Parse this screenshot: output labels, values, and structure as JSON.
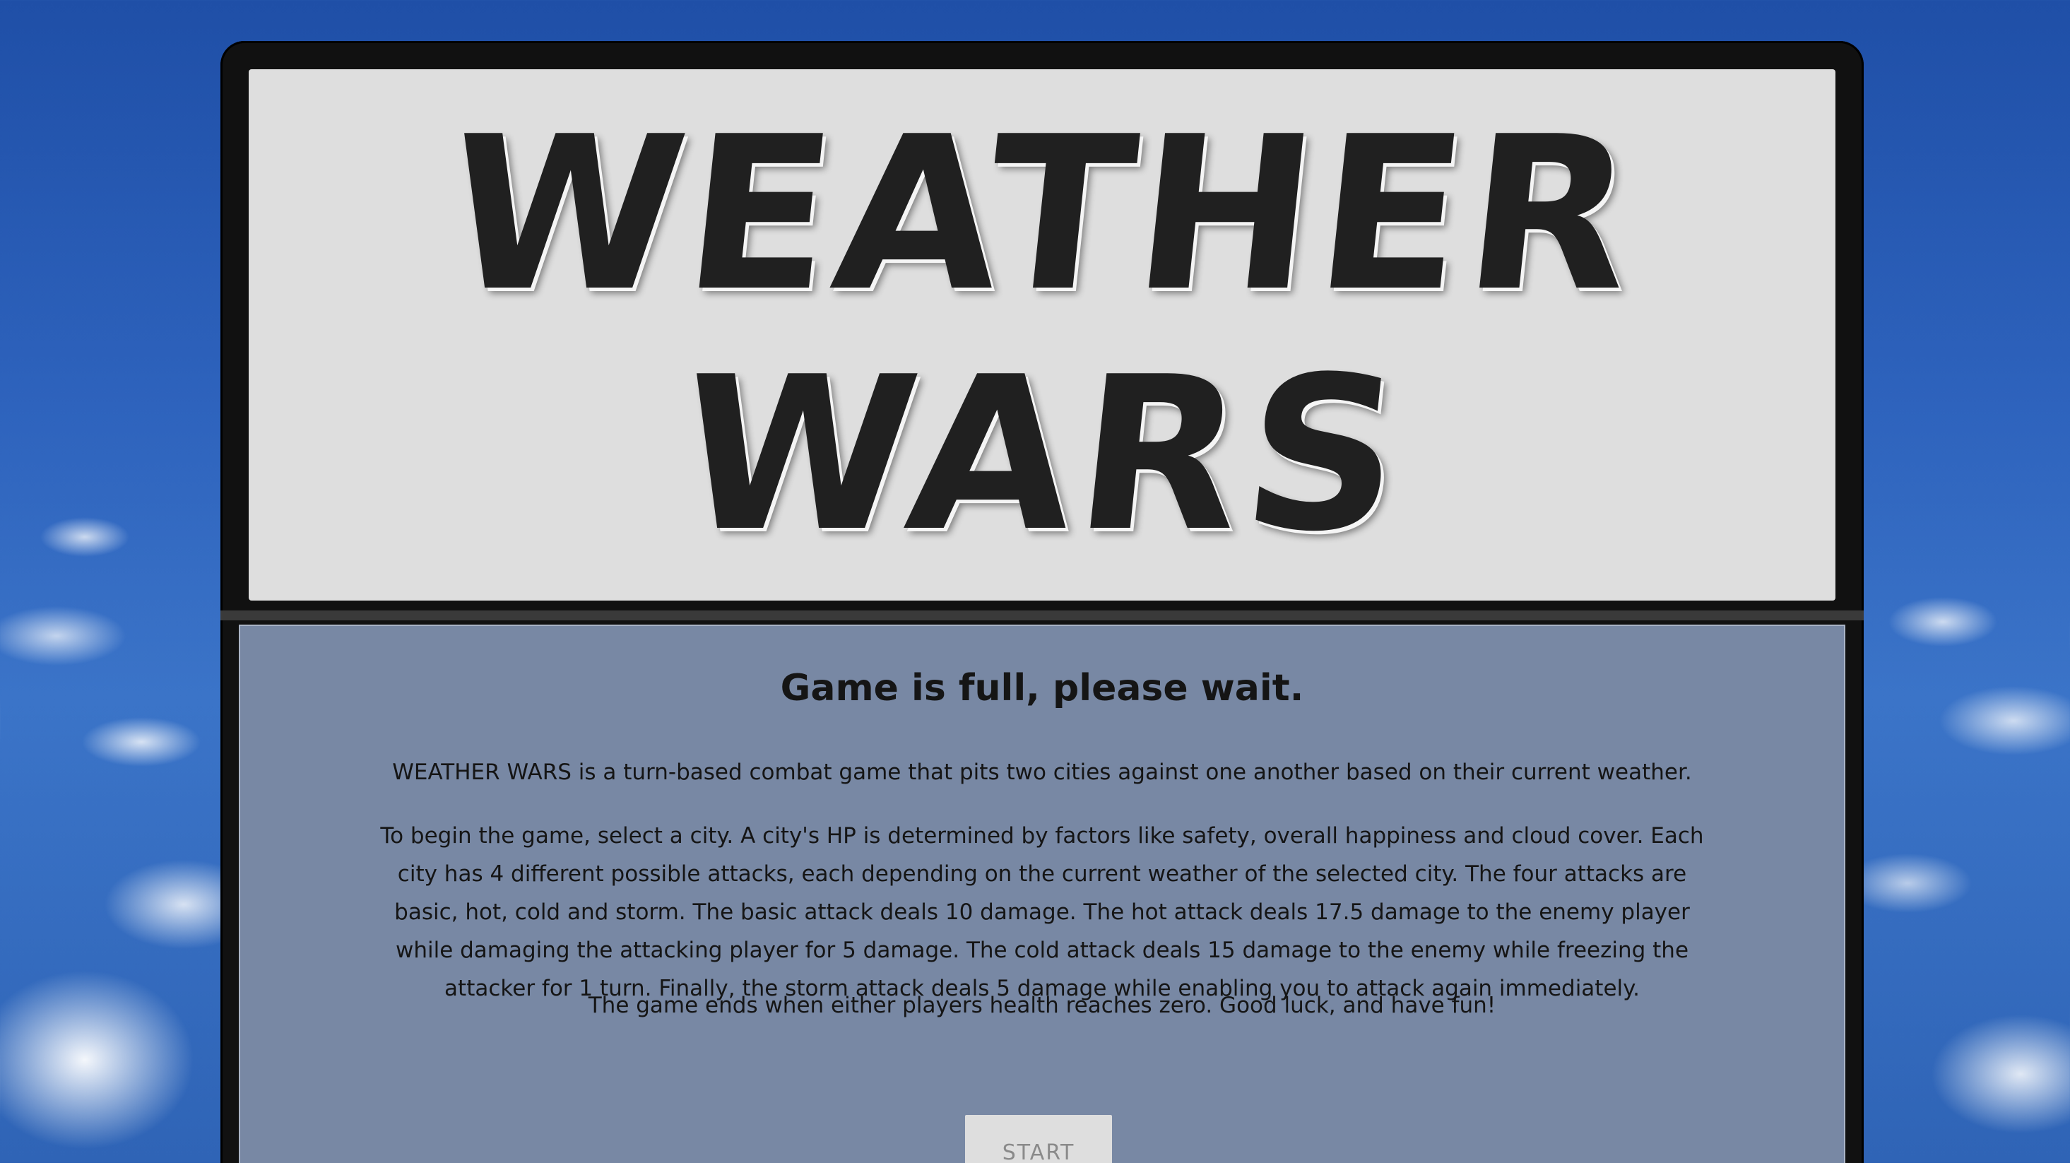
{
  "title": {
    "line1": "WEATHER",
    "line2": "WARS"
  },
  "status_message": "Game is full, please wait.",
  "intro": {
    "paragraph1": "WEATHER WARS is a turn-based combat game that pits two cities against one another based on their current weather.",
    "paragraph2": "To begin the game, select a city. A city's HP is determined by factors like safety, overall happiness and cloud cover. Each city has 4 different possible attacks, each depending on the current weather of the selected city. The four attacks are basic, hot, cold and storm. The basic attack deals 10 damage. The hot attack deals 17.5 damage to the enemy player while damaging the attacking player for 5 damage. The cold attack deals 15 damage to the enemy while freezing the attacker for 1 turn. Finally, the storm attack deals 5 damage while enabling you to attack again immediately.",
    "paragraph3": "The game ends when either players health reaches zero. Good luck, and have fun!"
  },
  "start_button": {
    "label": "START",
    "disabled": true
  },
  "colors": {
    "title_text": "#202020",
    "title_background": "#dedede",
    "content_background": "#7888a4",
    "frame": "#111111",
    "button_background": "#dedede",
    "button_text": "#8a8a8a"
  }
}
